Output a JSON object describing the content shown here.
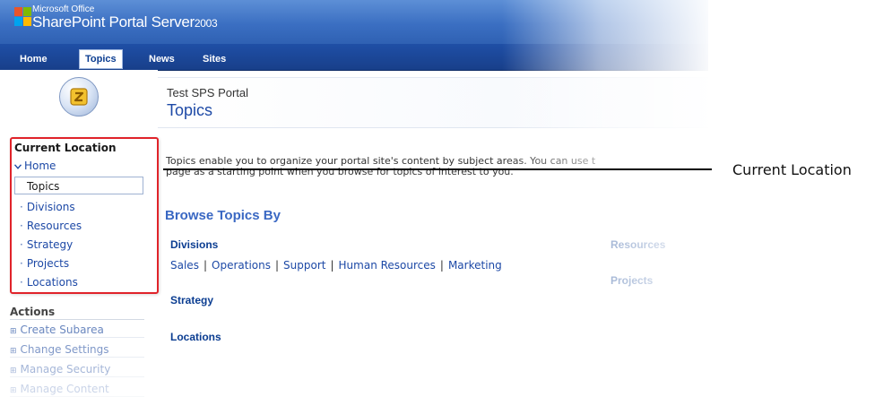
{
  "banner": {
    "office": "Microsoft Office",
    "product": "SharePoint Portal Server",
    "year": "2003",
    "colors": {
      "banner": "#3b6fc2",
      "nav": "#1f4fa6"
    }
  },
  "topnav": {
    "items": [
      {
        "label": "Home",
        "active": false
      },
      {
        "label": "Topics",
        "active": true
      },
      {
        "label": "News",
        "active": false
      },
      {
        "label": "Sites",
        "active": false
      }
    ]
  },
  "header": {
    "site_name": "Test SPS Portal",
    "page_title": "Topics"
  },
  "leftnav": {
    "current_location_title": "Current Location",
    "home_label": "Home",
    "current_item": "Topics",
    "subitems": [
      "Divisions",
      "Resources",
      "Strategy",
      "Projects",
      "Locations"
    ],
    "actions_title": "Actions",
    "actions": [
      "Create Subarea",
      "Change Settings",
      "Manage Security",
      "Manage Content"
    ]
  },
  "main": {
    "intro_line1": "Topics enable you to organize your portal site's content by subject areas. You can use t",
    "intro_line2": "page as a starting point when you browse for topics of interest to you.",
    "browse_title": "Browse Topics By",
    "categories": {
      "divisions": "Divisions",
      "resources": "Resources",
      "strategy": "Strategy",
      "projects": "Projects",
      "locations": "Locations"
    },
    "division_links": [
      "Sales",
      "Operations",
      "Support",
      "Human Resources",
      "Marketing"
    ]
  },
  "annotation": {
    "label": "Current Location",
    "highlight_color": "#e0232a"
  }
}
